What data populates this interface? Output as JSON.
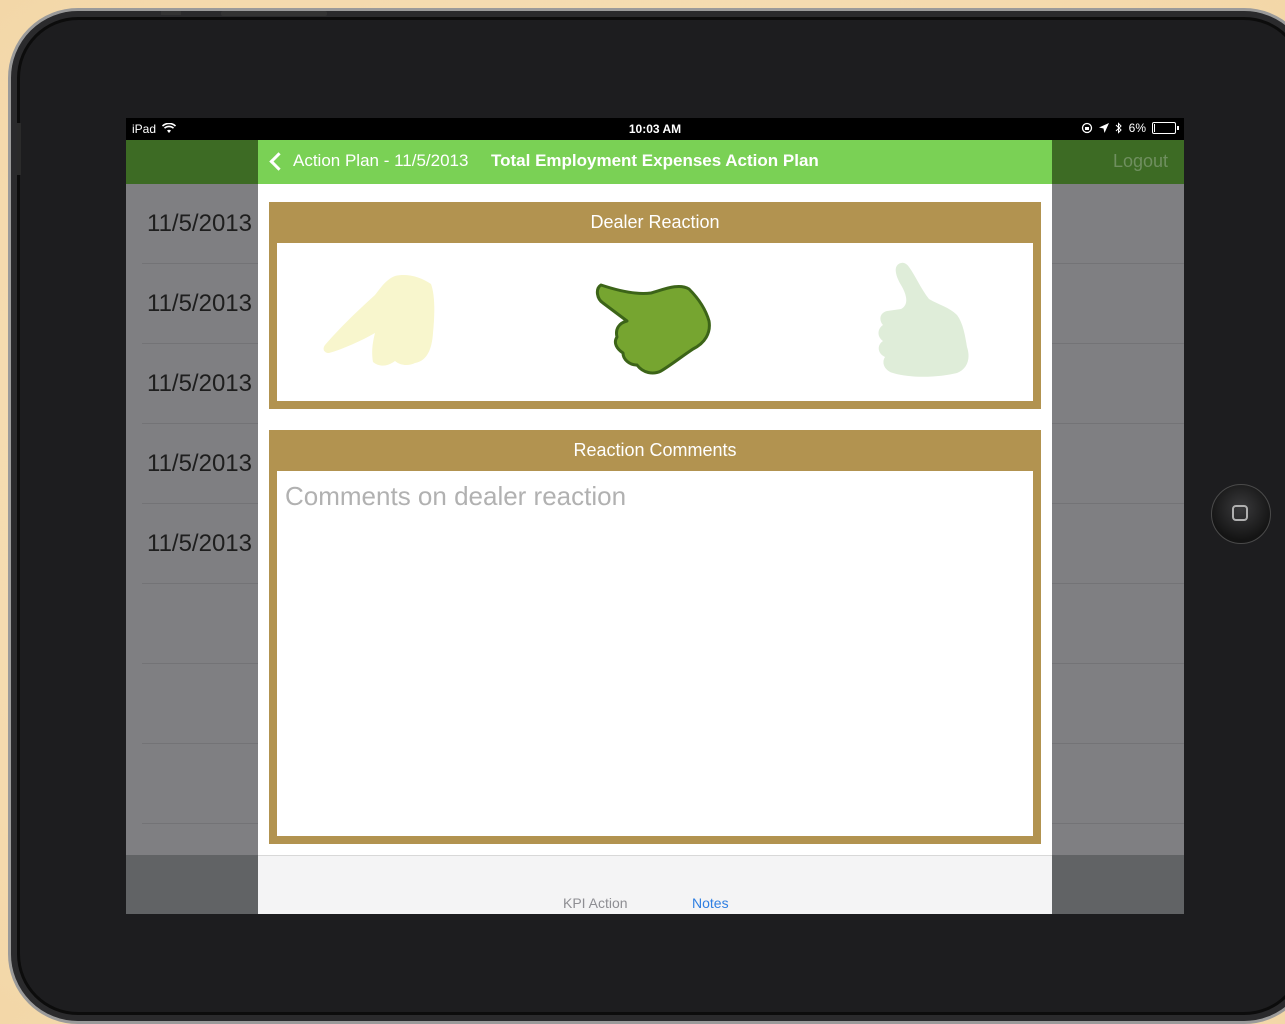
{
  "status_bar": {
    "device": "iPad",
    "time": "10:03 AM",
    "battery_percent": "6%",
    "battery_level": 0.06
  },
  "background": {
    "logout_label": "Logout",
    "dates": [
      "11/5/2013",
      "11/5/2013",
      "11/5/2013",
      "11/5/2013",
      "11/5/2013"
    ]
  },
  "modal": {
    "back_label": "Action Plan - 11/5/2013",
    "title": "Total Employment Expenses Action Plan",
    "dealer_reaction": {
      "header": "Dealer Reaction",
      "options": [
        {
          "name": "thumbs-down",
          "selected": false
        },
        {
          "name": "thumbs-sideways",
          "selected": true
        },
        {
          "name": "thumbs-up",
          "selected": false
        }
      ]
    },
    "comments": {
      "header": "Reaction Comments",
      "placeholder": "Comments on dealer reaction",
      "value": ""
    },
    "tabs": [
      {
        "label": "KPI Action",
        "active": false
      },
      {
        "label": "Notes",
        "active": true
      }
    ]
  },
  "colors": {
    "nav_green": "#7ad155",
    "panel_gold": "#b29350",
    "selected_hand": "#76a530",
    "active_tab": "#2f7fe2"
  }
}
